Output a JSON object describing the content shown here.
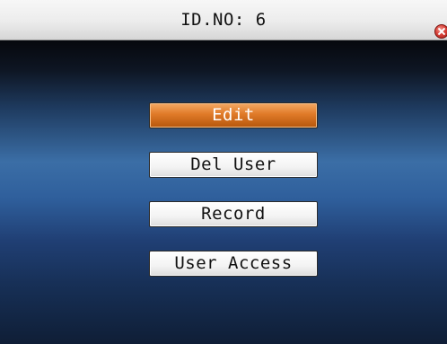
{
  "title_bar": {
    "title": "ID.NO: 6"
  },
  "icons": {
    "close": "close-icon"
  },
  "menu": {
    "selected_index": 0,
    "items": [
      {
        "label": "Edit"
      },
      {
        "label": "Del User"
      },
      {
        "label": "Record"
      },
      {
        "label": "User Access"
      }
    ]
  },
  "colors": {
    "selected_accent": "#e07a28",
    "background_blue": "#3b6ea6"
  }
}
